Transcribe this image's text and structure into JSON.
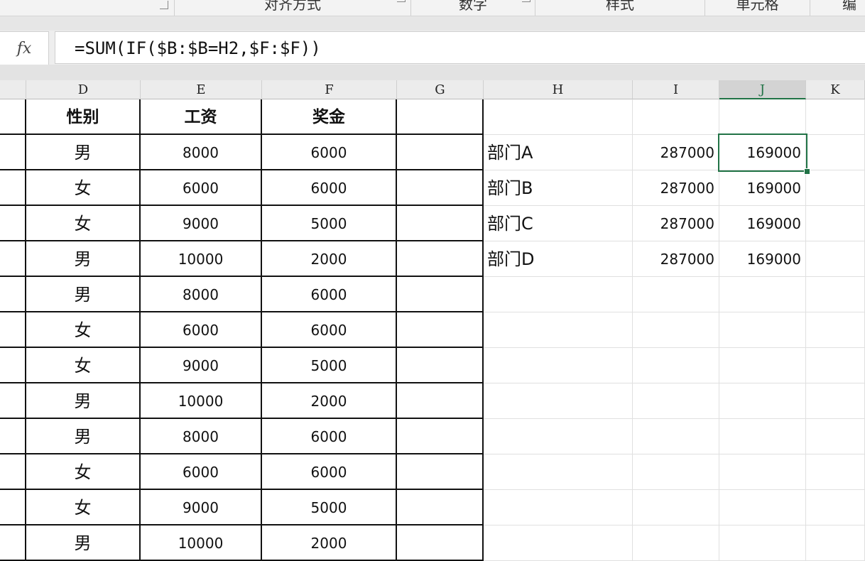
{
  "ribbon": {
    "groups": [
      {
        "label": "对齐方式"
      },
      {
        "label": "数字"
      },
      {
        "label": "样式"
      },
      {
        "label": "单元格"
      },
      {
        "label": "编"
      }
    ]
  },
  "formula_bar": {
    "fx_label": "fx",
    "formula": "=SUM(IF($B:$B=H2,$F:$F))"
  },
  "columns": [
    "D",
    "E",
    "F",
    "G",
    "H",
    "I",
    "J",
    "K"
  ],
  "selected_column": "J",
  "selected_cell": "J2",
  "table_headers": [
    "性别",
    "工资",
    "奖金"
  ],
  "table_rows": [
    [
      "男",
      "8000",
      "6000"
    ],
    [
      "女",
      "6000",
      "6000"
    ],
    [
      "女",
      "9000",
      "5000"
    ],
    [
      "男",
      "10000",
      "2000"
    ],
    [
      "男",
      "8000",
      "6000"
    ],
    [
      "女",
      "6000",
      "6000"
    ],
    [
      "女",
      "9000",
      "5000"
    ],
    [
      "男",
      "10000",
      "2000"
    ],
    [
      "男",
      "8000",
      "6000"
    ],
    [
      "女",
      "6000",
      "6000"
    ],
    [
      "女",
      "9000",
      "5000"
    ],
    [
      "男",
      "10000",
      "2000"
    ]
  ],
  "summary_rows": [
    [
      "部门A",
      "287000",
      "169000"
    ],
    [
      "部门B",
      "287000",
      "169000"
    ],
    [
      "部门C",
      "287000",
      "169000"
    ],
    [
      "部门D",
      "287000",
      "169000"
    ]
  ]
}
